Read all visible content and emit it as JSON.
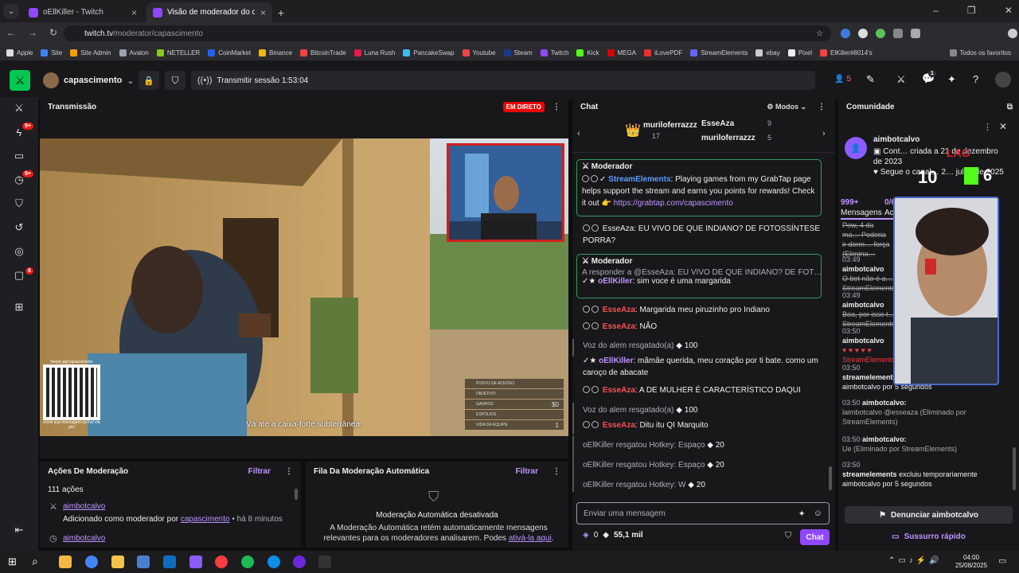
{
  "browser": {
    "tabs": [
      {
        "title": "oEllKiller - Twitch",
        "active": false
      },
      {
        "title": "Visão de moderador do ca…",
        "active": true
      }
    ],
    "url_host": "twitch.tv",
    "url_path": "/moderator/capascimento",
    "bookmarks": [
      "Apple",
      "Site",
      "Site Admin",
      "Avalon",
      "NETELLER",
      "CoinMarket",
      "Binance",
      "BitcoinTrade",
      "Luna Rush",
      "PancakeSwap",
      "Youtube",
      "Steam",
      "Twitch",
      "Kick",
      "MEGA",
      "iLovePDF",
      "StreamElements",
      "ebay",
      "Pixel",
      "ElKiller#8014's"
    ],
    "bookmarks_right": "Todos os favoritos"
  },
  "topnav": {
    "channel": "capascimento",
    "session": "Transmitir sessão 1:53:04",
    "viewers": "5",
    "notif_count": "1"
  },
  "rail": {
    "badge1": "9+",
    "badge2": "9+",
    "badge3": "6"
  },
  "stream": {
    "title": "Transmissão",
    "live_badge": "EM DIRETO",
    "subtitle": "Vá até a caixa-forte subterrânea.",
    "qr_caption": "livepix.gg/capascimento",
    "qr_note": "envie sua mensagem na live via pix!",
    "hud": [
      "PONTO DE ACESSO",
      "OBJETIVO",
      "GANHOS",
      "ESPÓLIOS",
      "VIDA DA EQUIPE"
    ],
    "hud_money": "$0",
    "hud_team": "1"
  },
  "mod_actions": {
    "title": "Ações De Moderação",
    "filter": "Filtrar",
    "count": "111 ações",
    "items": [
      {
        "user": "aimbotcalvo",
        "text_pre": "Adicionado como moderador por ",
        "by": "capascimento",
        "time": "• há 8 minutos"
      },
      {
        "user": "aimbotcalvo"
      }
    ]
  },
  "automod": {
    "title": "Fila Da Moderação Automática",
    "filter": "Filtrar",
    "heading": "Moderação Automática desativada",
    "body": "A Moderação Automática retém automaticamente mensagens relevantes para os moderadores analisarem. Podes ",
    "link": "ativá-la aqui",
    "end": "."
  },
  "chat": {
    "title": "Chat",
    "modes": "Modos",
    "leader": {
      "user1": "muriloferrazzz",
      "count1": "17",
      "user2": "EsseAza",
      "views2": "9",
      "user3": "muriloferrazzz",
      "views3": "5"
    },
    "messages": {
      "mod1_label": "Moderador",
      "mod1_user": "StreamElements",
      "mod1_text": ": Playing games from my GrabTap page helps support the stream and earns you points for rewards! Check it out",
      "mod1_emoji": "👉",
      "mod1_link": "https://grabtap.com/capascimento",
      "m2_text": "EsseAza: EU VIVO DE QUE INDIANO? DE FOTOSSÍNTESE PORRA?",
      "mod2_label": "Moderador",
      "mod2_reply": "A responder a @EsseAza: EU VIVO DE QUE INDIANO? DE FOT…",
      "mod2_user": "oEllKiller",
      "mod2_text": ": sim voce é uma margarida",
      "m3_user": "EsseAza",
      "m3_text": ": Margarida meu piruzinho pro Indiano",
      "m4_user": "EsseAza",
      "m4_text": ": NÃO",
      "m5_text": "Voz do alem resgatado(a)",
      "m5_pts": "100",
      "m6_user": "oEllKiller",
      "m6_text": ": mãmãe querida, meu coração por ti bate. como um caroço de abacate",
      "m7_user": "EsseAza",
      "m7_text": ": A DE MULHER É CARACTERÍSTICO DAQUI",
      "m8_text": "Voz do alem resgatado(a)",
      "m8_pts": "100",
      "m9_user": "EsseAza",
      "m9_text": ": Ditu itu QI Marquito",
      "m10_text": "oEllKiller resgatou Hotkey: Espaço",
      "m10_pts": "20",
      "m11_text": "oEllKiller resgatou Hotkey: Espaço",
      "m11_pts": "20",
      "m12_text": "oEllKiller resgatou Hotkey: W",
      "m12_pts": "20"
    },
    "input_placeholder": "Enviar uma mensagem",
    "bits": "0",
    "points": "55,1 mil",
    "send": "Chat"
  },
  "community": {
    "title": "Comunidade",
    "user": "aimbotcalvo",
    "created": "Cont… criada a 21 de dezembro de 2023",
    "follow": "Segue o canal… 2… julho de 2025",
    "tab1_count": "999+",
    "tab1": "Mensagens",
    "tab2_count": "0/6/2",
    "tab2": "Ac…",
    "overlay_n1": "10",
    "overlay_n2": "6",
    "overlay_tag": "LAG",
    "log": [
      {
        "time": "",
        "user": "",
        "text": "Pow, 4 da ma… Poderia ir dorm… força (Elimina…"
      },
      {
        "time": "03:49",
        "user": "aimbotcalvo",
        "text": "O bot não é a… StreamElements…"
      },
      {
        "time": "03:49",
        "user": "aimbotcalvo",
        "text": "Boa, por isso t… StreamElements…"
      },
      {
        "time": "03:50",
        "user": "aimbotcalvo",
        "text": "♥ ♥ ♥ ♥ ♥ StreamElements…"
      },
      {
        "time": "03:50",
        "user": "streamelements",
        "text": "aimbotcalvo por 5 segundos"
      },
      {
        "time": "03:50",
        "user": "aimbotcalvo:",
        "text": "laimbotcalvo @esseaza (Eliminado por StreamElements)"
      },
      {
        "time": "03:50",
        "user": "aimbotcalvo:",
        "text": "Ue (Eliminado por StreamElements)"
      },
      {
        "time": "03:50",
        "user": "streamelements",
        "text": "excluiu temporariamente aimbotcalvo por 5 segundos"
      }
    ],
    "report": "Denunciar aimbotcalvo",
    "whisper": "Sussurro rápido"
  },
  "taskbar": {
    "time": "04:00",
    "date": "25/08/2025"
  }
}
